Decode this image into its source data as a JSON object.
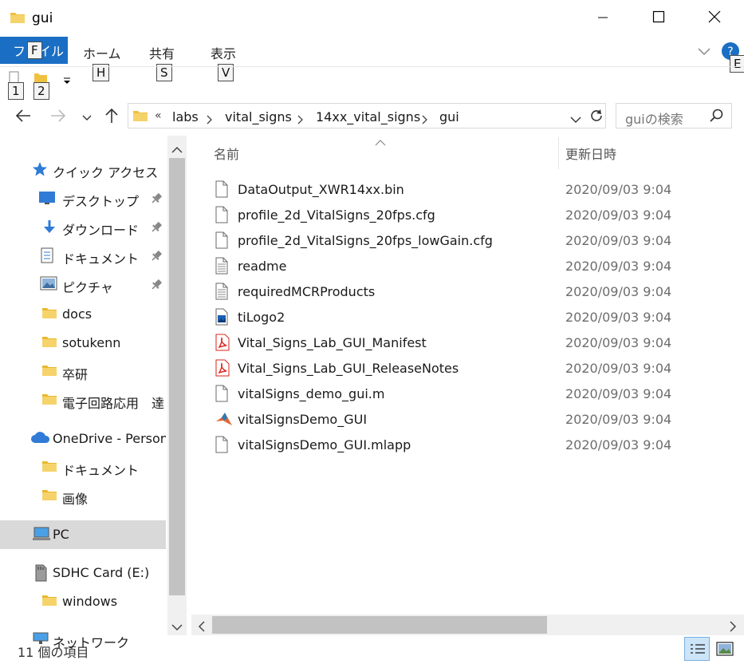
{
  "window": {
    "title": "gui",
    "icons": {
      "folder": "folder-icon",
      "minimize": "minimize-icon",
      "maximize": "maximize-icon",
      "close": "close-icon"
    }
  },
  "ribbon": {
    "file_tab": "ファイル",
    "file_keytip": "F",
    "tabs": [
      {
        "label": "ホーム",
        "keytip": "H"
      },
      {
        "label": "共有",
        "keytip": "S"
      },
      {
        "label": "表示",
        "keytip": "V"
      }
    ],
    "help_keytip": "E",
    "qat_keytips": [
      "1",
      "2"
    ]
  },
  "address": {
    "overflow": "«",
    "crumbs": [
      "labs",
      "vital_signs",
      "14xx_vital_signs",
      "gui"
    ],
    "search_placeholder": "guiの検索"
  },
  "nav": {
    "items": [
      {
        "label": "クイック アクセス",
        "icon": "star-icon",
        "pinned": false
      },
      {
        "label": "デスクトップ",
        "icon": "desktop-icon",
        "pinned": true
      },
      {
        "label": "ダウンロード",
        "icon": "download-icon",
        "pinned": true
      },
      {
        "label": "ドキュメント",
        "icon": "document-icon",
        "pinned": true
      },
      {
        "label": "ピクチャ",
        "icon": "picture-icon",
        "pinned": true
      },
      {
        "label": "docs",
        "icon": "folder-icon",
        "pinned": false
      },
      {
        "label": "sotukenn",
        "icon": "folder-icon",
        "pinned": false
      },
      {
        "label": "卒研",
        "icon": "folder-icon",
        "pinned": false
      },
      {
        "label": "電子回路応用　達",
        "icon": "folder-icon",
        "pinned": false
      },
      {
        "label": "OneDrive - Personal",
        "icon": "cloud-icon",
        "pinned": false
      },
      {
        "label": "ドキュメント",
        "icon": "folder-icon",
        "pinned": false
      },
      {
        "label": "画像",
        "icon": "folder-icon",
        "pinned": false
      },
      {
        "label": "PC",
        "icon": "pc-icon",
        "pinned": false
      },
      {
        "label": "SDHC Card (E:)",
        "icon": "sdcard-icon",
        "pinned": false
      },
      {
        "label": "windows",
        "icon": "folder-icon",
        "pinned": false
      },
      {
        "label": "ネットワーク",
        "icon": "network-icon",
        "pinned": false
      }
    ]
  },
  "columns": {
    "name": "名前",
    "date": "更新日時"
  },
  "files": [
    {
      "name": "DataOutput_XWR14xx.bin",
      "date": "2020/09/03 9:04",
      "icon": "file-icon"
    },
    {
      "name": "profile_2d_VitalSigns_20fps.cfg",
      "date": "2020/09/03 9:04",
      "icon": "file-icon"
    },
    {
      "name": "profile_2d_VitalSigns_20fps_lowGain.cfg",
      "date": "2020/09/03 9:04",
      "icon": "file-icon"
    },
    {
      "name": "readme",
      "date": "2020/09/03 9:04",
      "icon": "text-file-icon"
    },
    {
      "name": "requiredMCRProducts",
      "date": "2020/09/03 9:04",
      "icon": "text-file-icon"
    },
    {
      "name": "tiLogo2",
      "date": "2020/09/03 9:04",
      "icon": "image-file-icon"
    },
    {
      "name": "Vital_Signs_Lab_GUI_Manifest",
      "date": "2020/09/03 9:04",
      "icon": "pdf-icon"
    },
    {
      "name": "Vital_Signs_Lab_GUI_ReleaseNotes",
      "date": "2020/09/03 9:04",
      "icon": "pdf-icon"
    },
    {
      "name": "vitalSigns_demo_gui.m",
      "date": "2020/09/03 9:04",
      "icon": "file-icon"
    },
    {
      "name": "vitalSignsDemo_GUI",
      "date": "2020/09/03 9:04",
      "icon": "matlab-icon"
    },
    {
      "name": "vitalSignsDemo_GUI.mlapp",
      "date": "2020/09/03 9:04",
      "icon": "file-icon"
    }
  ],
  "status": {
    "item_count": "11 個の項目"
  },
  "colors": {
    "accent": "#1a6fc4",
    "folder": "#f0c040",
    "pdf": "#d9241c",
    "selected": "#d9d9d9"
  }
}
